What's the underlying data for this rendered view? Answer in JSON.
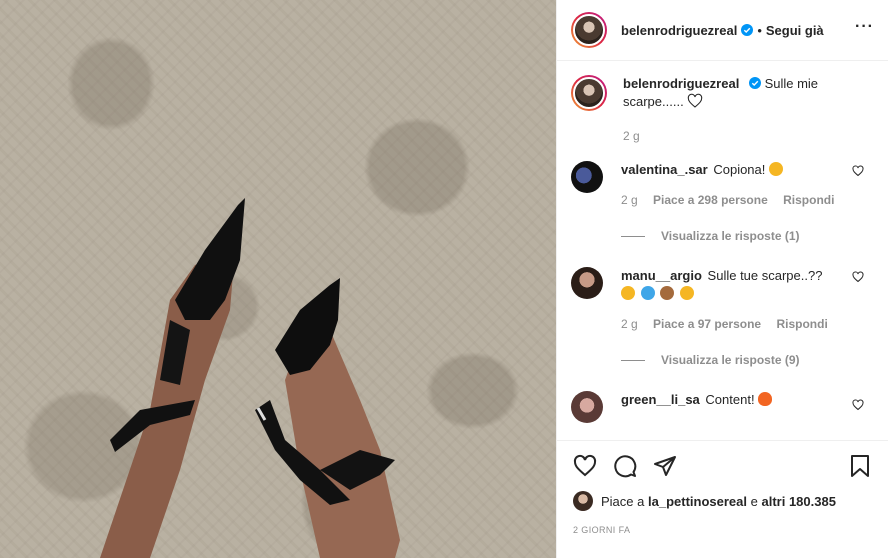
{
  "post": {
    "username": "belenrodriguezreal",
    "follow_status": "Segui già",
    "more_icon": "more-options-icon",
    "caption": {
      "text": "Sulle mie scarpe......",
      "time": "2 g"
    }
  },
  "comments": [
    {
      "username": "valentina_.sar",
      "text": "Copiona!",
      "emojis": [
        "tongue-face"
      ],
      "time": "2 g",
      "likes": "Piace a 298 persone",
      "reply_label": "Rispondi",
      "view_replies": "Visualizza le risposte (1)"
    },
    {
      "username": "manu__argio",
      "text": "Sulle tue scarpe..??",
      "emojis": [
        "scream-face",
        "sweat-drops",
        "see-no-evil-monkey",
        "tears-of-joy"
      ],
      "time": "2 g",
      "likes": "Piace a 97 persone",
      "reply_label": "Rispondi",
      "view_replies": "Visualizza le risposte (9)"
    },
    {
      "username": "green__li_sa",
      "text": "Content!",
      "emojis": [
        "fire"
      ]
    }
  ],
  "footer": {
    "likes_prefix": "Piace a",
    "likes_user": "la_pettinosereal",
    "likes_suffix": "e",
    "likes_others": "altri 180.385",
    "date": "2 GIORNI FA"
  },
  "colors": {
    "border": "#efefef",
    "muted": "#8e8e8e",
    "text": "#262626",
    "verified": "#0095f6"
  }
}
